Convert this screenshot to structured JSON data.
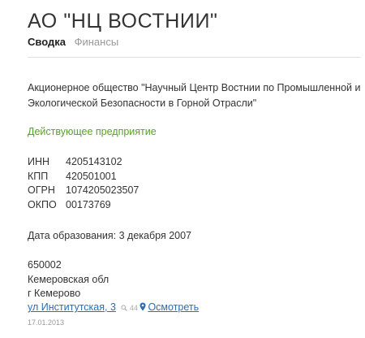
{
  "company": {
    "title": "АО \"НЦ ВОСТНИИ\"",
    "full_name": "Акционерное общество \"Научный Центр Востнии по Промышленной и Экологической Безопасности в Горной Отрасли\"",
    "status": "Действующее предприятие"
  },
  "tabs": [
    {
      "label": "Сводка",
      "active": true
    },
    {
      "label": "Финансы",
      "active": false
    }
  ],
  "codes": [
    {
      "key": "ИНН",
      "value": "4205143102"
    },
    {
      "key": "КПП",
      "value": "420501001"
    },
    {
      "key": "ОГРН",
      "value": "1074205023507"
    },
    {
      "key": "ОКПО",
      "value": "00173769"
    }
  ],
  "founded": "Дата образования: 3 декабря 2007",
  "address": {
    "postcode": "650002",
    "region": "Кемеровская обл",
    "city": "г Кемерово",
    "street": "ул Институтская, 3",
    "views": "44",
    "map_label": "Осмотреть"
  },
  "updated": "17.01.2013",
  "colors": {
    "text": "#333333",
    "status_green": "#5aa02c",
    "link_blue": "#2d6db5",
    "muted": "#999999"
  }
}
